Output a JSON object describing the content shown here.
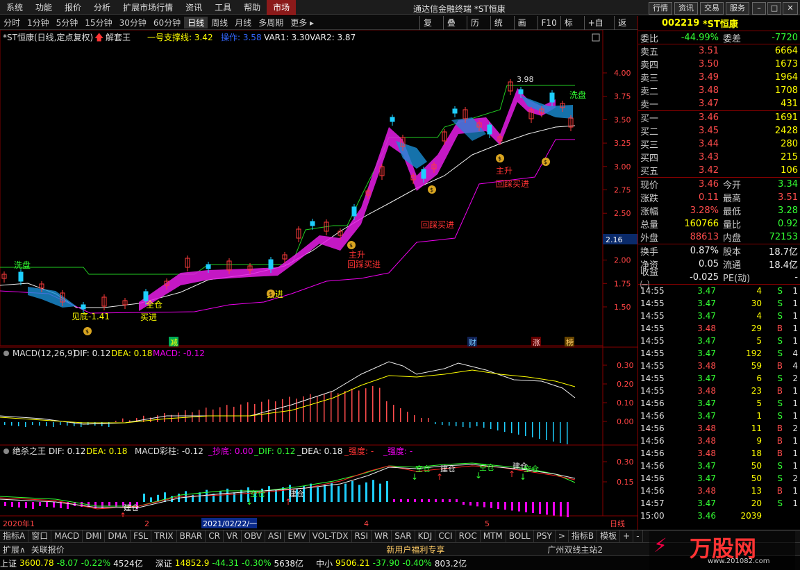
{
  "menu": [
    "系统",
    "功能",
    "报价",
    "分析",
    "扩展市场行情",
    "资讯",
    "工具",
    "帮助",
    "市场"
  ],
  "window_title": "通达信金融终端 *ST恒康",
  "window_buttons": [
    "行情",
    "资讯",
    "交易",
    "服务"
  ],
  "periods": [
    "分时",
    "1分钟",
    "5分钟",
    "15分钟",
    "30分钟",
    "60分钟",
    "日线",
    "周线",
    "月线",
    "多周期",
    "更多 ▸"
  ],
  "selected_period": "日线",
  "tools": [
    "复权",
    "叠加",
    "历史",
    "统计",
    "画线",
    "F10",
    "标记",
    "+自选",
    "返回"
  ],
  "main_header": {
    "name": "*ST恒康(日线,定点复权)",
    "indicator": "解套王",
    "support": "一号支撑线: 3.42",
    "op": "操作: 3.58",
    "var1": "VAR1: 3.30",
    "var2": "VAR2: 3.87"
  },
  "price_axis": [
    "4.00",
    "3.75",
    "3.50",
    "3.25",
    "3.00",
    "2.75",
    "2.50",
    "2.25",
    "2.00",
    "1.75",
    "1.50"
  ],
  "current_price_tag": "2.16",
  "annotations": {
    "high": "3.98",
    "low": "见底-1.41",
    "wash1": "洗盘",
    "wash2": "洗盘",
    "full": "全仓",
    "buy": "买进",
    "add": "买进",
    "rise1": "主升",
    "rise2": "主升",
    "pull1": "回踩买进",
    "pull2": "回踩买进",
    "pull3": "回踩买进",
    "reduce": "减",
    "cai": "财",
    "zhang": "涨",
    "bang": "榜",
    "percentlabel": "%"
  },
  "macd": {
    "header": "MACD(12,26,9)",
    "dif": "DIF: 0.12",
    "dea": "DEA: 0.18",
    "macd": "MACD: -0.12",
    "axis": [
      "0.30",
      "0.20",
      "0.10",
      "0.00"
    ]
  },
  "jsw": {
    "header": "绝杀之王",
    "dif": "DIF: 0.12",
    "dea": "DEA: 0.18",
    "cz": "MACD彩柱: -0.12",
    "cd": "_抄底: 0.00",
    "dif2": "_DIF: 0.12",
    "dea2": "_DEA: 0.18",
    "qd": "_强度: -",
    "qd2": "_强度: -",
    "axis": [
      "0.30",
      "0.15"
    ],
    "signals": [
      "建仓",
      "空仓",
      "建仓",
      "空仓",
      "建仓",
      "空仓",
      "建仓",
      "空仓"
    ]
  },
  "date_axis": [
    "2020年1",
    "2",
    "2021/02/22/一",
    "4",
    "5",
    "日线"
  ],
  "stock": {
    "code": "002219",
    "name": "*ST恒康"
  },
  "weibi": {
    "label": "委比",
    "value": "-44.99%",
    "label2": "委差",
    "value2": "-7720"
  },
  "asks": [
    {
      "label": "卖五",
      "price": "3.51",
      "vol": "6664"
    },
    {
      "label": "卖四",
      "price": "3.50",
      "vol": "1673"
    },
    {
      "label": "卖三",
      "price": "3.49",
      "vol": "1964"
    },
    {
      "label": "卖二",
      "price": "3.48",
      "vol": "1708"
    },
    {
      "label": "卖一",
      "price": "3.47",
      "vol": "431"
    }
  ],
  "bids": [
    {
      "label": "买一",
      "price": "3.46",
      "vol": "1691"
    },
    {
      "label": "买二",
      "price": "3.45",
      "vol": "2428"
    },
    {
      "label": "买三",
      "price": "3.44",
      "vol": "280"
    },
    {
      "label": "买四",
      "price": "3.43",
      "vol": "215"
    },
    {
      "label": "买五",
      "price": "3.42",
      "vol": "106"
    }
  ],
  "stats": [
    {
      "l": "现价",
      "v": "3.46",
      "vc": "red",
      "l2": "今开",
      "v2": "3.34",
      "v2c": "grn"
    },
    {
      "l": "涨跌",
      "v": "0.11",
      "vc": "red",
      "l2": "最高",
      "v2": "3.51",
      "v2c": "red"
    },
    {
      "l": "涨幅",
      "v": "3.28%",
      "vc": "red",
      "l2": "最低",
      "v2": "3.28",
      "v2c": "grn"
    },
    {
      "l": "总量",
      "v": "160766",
      "vc": "yel",
      "l2": "量比",
      "v2": "0.92",
      "v2c": "grn"
    },
    {
      "l": "外盘",
      "v": "88613",
      "vc": "red",
      "l2": "内盘",
      "v2": "72153",
      "v2c": "grn"
    }
  ],
  "stats2": [
    {
      "l": "换手",
      "v": "0.87%",
      "vc": "wht",
      "l2": "股本",
      "v2": "18.7亿",
      "v2c": "wht"
    },
    {
      "l": "净资",
      "v": "0.05",
      "vc": "wht",
      "l2": "流通",
      "v2": "18.4亿",
      "v2c": "wht"
    },
    {
      "l": "收益㈠",
      "v": "-0.025",
      "vc": "wht",
      "l2": "PE(动)",
      "v2": "-",
      "v2c": "wht"
    }
  ],
  "ticks": [
    [
      "14:55",
      "3.47",
      "4",
      "S",
      "1"
    ],
    [
      "14:55",
      "3.47",
      "30",
      "S",
      "1"
    ],
    [
      "14:55",
      "3.47",
      "4",
      "S",
      "1"
    ],
    [
      "14:55",
      "3.48",
      "29",
      "B",
      "1"
    ],
    [
      "14:55",
      "3.47",
      "5",
      "S",
      "1"
    ],
    [
      "14:55",
      "3.47",
      "192",
      "S",
      "4"
    ],
    [
      "14:55",
      "3.48",
      "59",
      "B",
      "4"
    ],
    [
      "14:55",
      "3.47",
      "6",
      "S",
      "2"
    ],
    [
      "14:55",
      "3.48",
      "23",
      "B",
      "1"
    ],
    [
      "14:56",
      "3.47",
      "5",
      "S",
      "1"
    ],
    [
      "14:56",
      "3.47",
      "1",
      "S",
      "1"
    ],
    [
      "14:56",
      "3.48",
      "11",
      "B",
      "2"
    ],
    [
      "14:56",
      "3.48",
      "9",
      "B",
      "1"
    ],
    [
      "14:56",
      "3.48",
      "18",
      "B",
      "1"
    ],
    [
      "14:56",
      "3.47",
      "50",
      "S",
      "1"
    ],
    [
      "14:56",
      "3.47",
      "50",
      "S",
      "2"
    ],
    [
      "14:56",
      "3.48",
      "13",
      "B",
      "1"
    ],
    [
      "14:57",
      "3.47",
      "20",
      "S",
      "1"
    ],
    [
      "15:00",
      "3.46",
      "2039",
      "",
      ""
    ]
  ],
  "indicator_tabs": [
    "指标A",
    "窗口",
    "MACD",
    "DMI",
    "DMA",
    "FSL",
    "TRIX",
    "BRAR",
    "CR",
    "VR",
    "OBV",
    "ASI",
    "EMV",
    "VOL-TDX",
    "RSI",
    "WR",
    "SAR",
    "KDJ",
    "CCI",
    "ROC",
    "MTM",
    "BOLL",
    "PSY",
    ">",
    "指标B",
    "模板",
    "+",
    "-"
  ],
  "status_left": [
    "扩展∧",
    "关联报价"
  ],
  "status_right": [
    "新用户福利专享",
    "广州双线主站2"
  ],
  "index_bar": [
    {
      "name": "上证",
      "v": "3600.78",
      "c": "-8.07",
      "p": "-0.22%",
      "a": "4524亿"
    },
    {
      "name": "深证",
      "v": "14852.9",
      "c": "-44.31",
      "p": "-0.30%",
      "a": "5638亿"
    },
    {
      "name": "中小",
      "v": "9506.21",
      "c": "-37.90",
      "p": "-0.40%",
      "a": "803.2亿"
    }
  ],
  "watermark": {
    "text": "万股网",
    "url": "www.201082.com"
  },
  "colors": {
    "up": "#ff4c4c",
    "down": "#00e5ff",
    "support": "#ffff00",
    "accent": "#8b1a1a"
  }
}
